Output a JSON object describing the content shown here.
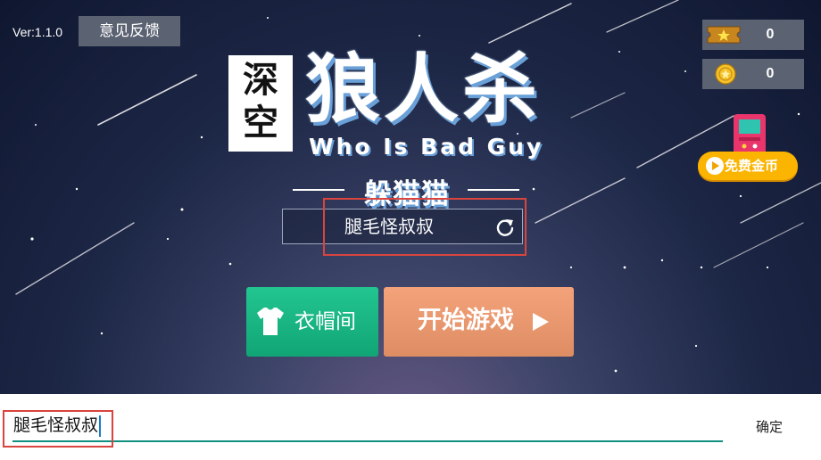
{
  "header": {
    "version": "Ver:1.1.0",
    "feedback_label": "意见反馈"
  },
  "logo": {
    "deep_text": "深空",
    "main_title": "狼人杀",
    "subtitle": "Who Is Bad Guy",
    "mode": "躲猫猫"
  },
  "nickname": {
    "value": "腿毛怪叔叔",
    "refresh_icon": "refresh-icon"
  },
  "buttons": {
    "wardrobe_label": "衣帽间",
    "start_label": "开始游戏"
  },
  "currency": {
    "tickets": "0",
    "coins": "0",
    "free_coins_label": "免费金币"
  },
  "input_bar": {
    "value": "腿毛怪叔叔",
    "confirm_label": "确定"
  },
  "colors": {
    "wardrobe_green": "#11a575",
    "start_orange": "#e38f66",
    "free_coin_yellow": "#fbb400",
    "highlight_red": "#d9453e",
    "underline_teal": "#118f80"
  }
}
